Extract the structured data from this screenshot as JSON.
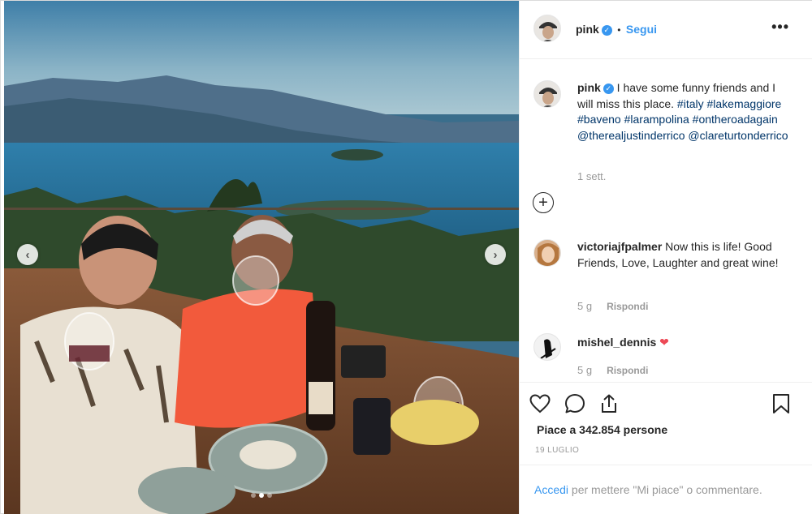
{
  "post": {
    "username": "pink",
    "follow_label": "Segui",
    "follow_separator": "•",
    "more_label": "•••"
  },
  "caption": {
    "username": "pink",
    "text": "I have some funny friends and I will miss this place.",
    "tags": [
      "#italy",
      "#lakemaggiore",
      "#baveno",
      "#larampolina",
      "#ontheroadagain",
      "@therealjustinderrico",
      "@clareturtonderrico"
    ],
    "time": "1 sett."
  },
  "comments": [
    {
      "username": "victoriajfpalmer",
      "text": "Now this is life! Good Friends, Love, Laughter and great wine!",
      "time": "5 g",
      "reply_label": "Rispondi"
    },
    {
      "username": "mishel_dennis",
      "text": "❤",
      "time": "5 g",
      "reply_label": "Rispondi"
    }
  ],
  "load_more_label": "+",
  "likes_text": "Piace a 342.854 persone",
  "date_text": "19 LUGLIO",
  "login": {
    "link": "Accedi",
    "text": " per mettere \"Mi piace\" o commentare."
  },
  "carousel": {
    "slide_count": 3,
    "active_index": 1,
    "prev_label": "‹",
    "next_label": "›"
  },
  "colors": {
    "accent": "#3897f0",
    "text": "#262626",
    "muted": "#999999",
    "heart": "#ed4956",
    "tag": "#003569"
  },
  "icons": [
    "verified-badge-icon",
    "more-options-icon",
    "load-more-comments-icon",
    "like-heart-icon",
    "comment-icon",
    "share-icon",
    "save-bookmark-icon",
    "comment-heart-icon",
    "carousel-prev-icon",
    "carousel-next-icon"
  ]
}
